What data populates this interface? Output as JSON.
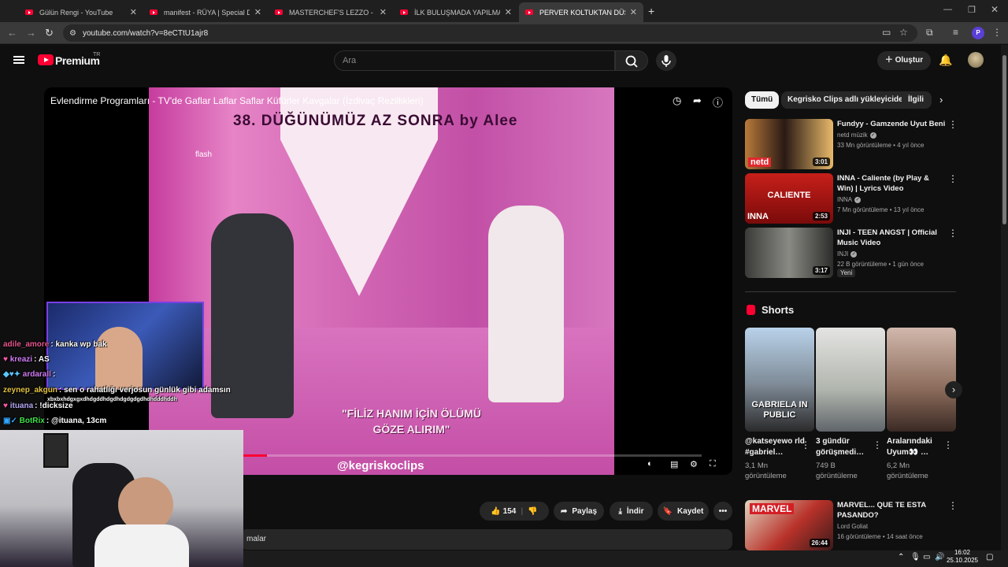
{
  "browser": {
    "tabs": [
      {
        "title": "Gülün Rengi - YouTube",
        "active": false
      },
      {
        "title": "manifest - RÜYA | Special Dance",
        "active": false
      },
      {
        "title": "MASTERCHEF'S LEZZO - YouTube",
        "active": false
      },
      {
        "title": "İLK BULUŞMADA YAPILMAMASI",
        "active": false
      },
      {
        "title": "PERVER KOLTUKTAN DÜŞÜYOR",
        "active": true
      }
    ],
    "new_tab": "+",
    "url": "youtube.com/watch?v=8eCTtU1ajr8",
    "profile_initial": "P"
  },
  "masthead": {
    "brand": "Premium",
    "brand_sup": "TR",
    "search_placeholder": "Ara",
    "create_label": "Oluştur"
  },
  "player": {
    "title": "Evlendirme Programları - TV'de Gaflar Laflar Saflar Küfürler Kavgalar (İzdivaç Rezillikleri)",
    "overlay_top": "38. DÜĞÜNÜMÜZ AZ SONRA by Alee",
    "overlay_caption_line1": "\"FİLİZ HANIM İÇİN ÖLÜMÜ",
    "overlay_caption_line2": "GÖZE ALIRIM\"",
    "watermark": "@kegriskoclips",
    "progress": 0.06
  },
  "actions": {
    "likes": "154",
    "share": "Paylaş",
    "download": "İndir",
    "save": "Kaydet",
    "comments_fragment": "malar"
  },
  "sidebar": {
    "chips": [
      "Tümü",
      "Kegrisko Clips adlı yükleyiciden",
      "İlgili"
    ],
    "related": [
      {
        "title": "Fundyy - Gamzende Uyut Beni",
        "channel": "netd müzik",
        "meta": "33 Mn görüntüleme • 4 yıl önce",
        "duration": "3:01",
        "thumb_text": "netd"
      },
      {
        "title": "INNA - Caliente (by Play & Win) | Lyrics Video",
        "channel": "INNA",
        "meta": "7 Mn görüntüleme • 13 yıl önce",
        "duration": "2:53",
        "thumb_text": "CALIENTE",
        "thumb_text2": "INNA"
      },
      {
        "title": "INJI - TEEN ANGST | Official Music Video",
        "channel": "INJI",
        "meta": "22 B görüntüleme • 1 gün önce",
        "duration": "3:17",
        "badge": "Yeni"
      },
      {
        "title": "MARVEL... QUE TE ESTA PASANDO?",
        "channel": "Lord Goliat",
        "meta": "16 görüntüleme • 14 saat önce",
        "duration": "26:44",
        "thumb_text": "MARVEL"
      }
    ],
    "shorts_label": "Shorts",
    "shorts": [
      {
        "title": "@katseyewo rld #gabriel…",
        "views": "3,1 Mn görüntüleme",
        "thumb_text": "GABRIELA IN PUBLIC"
      },
      {
        "title": "3 gündür görüşmedi…",
        "views": "749 B görüntüleme"
      },
      {
        "title": "Aralarındaki Uyum👀 …",
        "views": "6,2 Mn görüntüleme"
      }
    ]
  },
  "chat": [
    {
      "user": "adile_amore",
      "msg": ": kanka wp bak",
      "color": "#e6568f"
    },
    {
      "user": "kreazi",
      "msg": ": AS",
      "color": "#cf7cf2"
    },
    {
      "user": "ardarall",
      "msg": ":",
      "color": "#cf7cf2"
    },
    {
      "user": "zeynep_akgun",
      "msg": ": sen o rahatlığı verjosun günlük gibi adamsın",
      "color": "#e3c33f"
    },
    {
      "user": "",
      "msg": "xbxbxhdgxgxdhdgddhdgdhdgdgdgdhdhdddhddh",
      "color": "#ffffff"
    },
    {
      "user": "ituana",
      "msg": ": !dicksize",
      "color": "#b4a7f5"
    },
    {
      "user": "BotRix",
      "msg": ": @ituana, 13cm",
      "color": "#3fe04b"
    }
  ],
  "taskbar": {
    "time": "16:02",
    "date": "25.10.2025"
  },
  "colors": {
    "accent_red": "#ff0033",
    "cam_border": "#7b3fe4"
  }
}
